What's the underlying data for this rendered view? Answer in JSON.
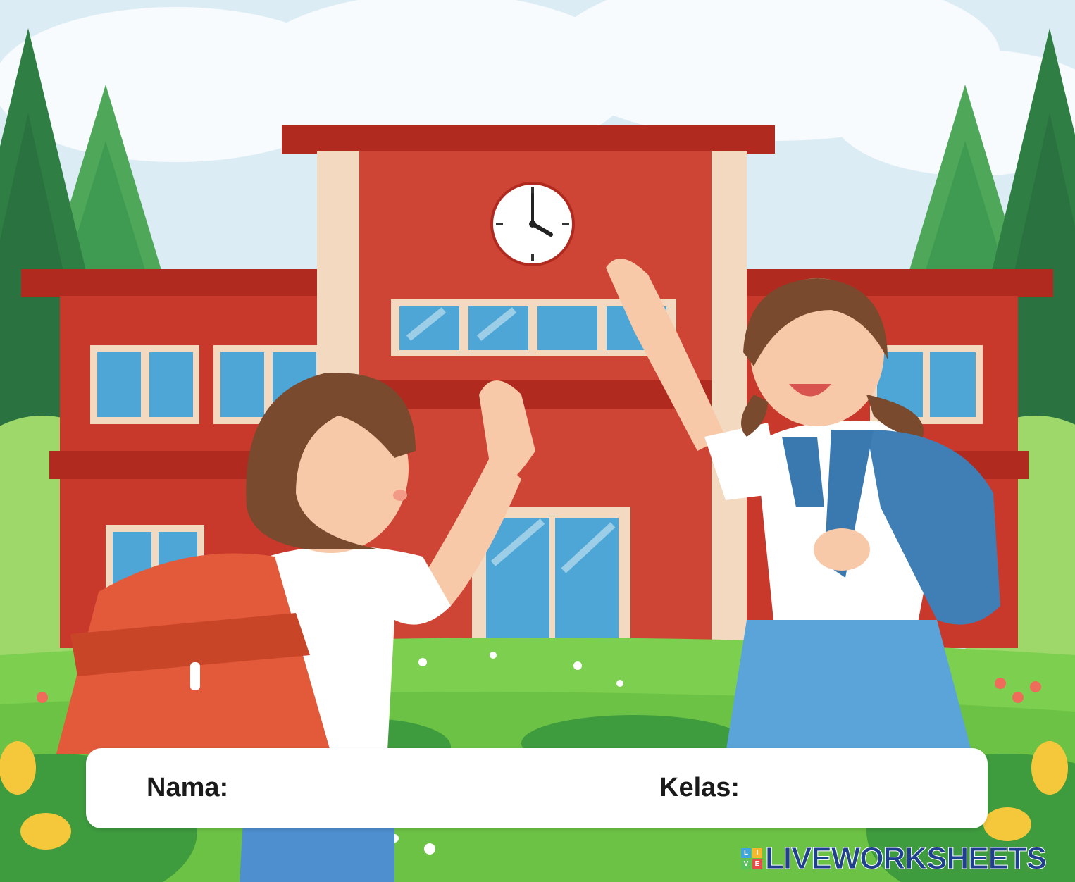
{
  "form": {
    "name_label": "Nama:",
    "class_label": "Kelas:",
    "name_value": "",
    "class_value": ""
  },
  "brand": {
    "text": "LIVEWORKSHEETS",
    "logo_letters": [
      "L",
      "I",
      "V",
      "E"
    ]
  },
  "clock": {
    "hour": 4,
    "minute": 0
  },
  "colors": {
    "sky": "#dcecf5",
    "building": "#c8392b",
    "roof": "#b12a20",
    "trim": "#f2d9bf",
    "window": "#4ea6d6",
    "grass": "#7ccf4f",
    "tree": "#3f9a52",
    "brand": "#1f3f8f"
  }
}
